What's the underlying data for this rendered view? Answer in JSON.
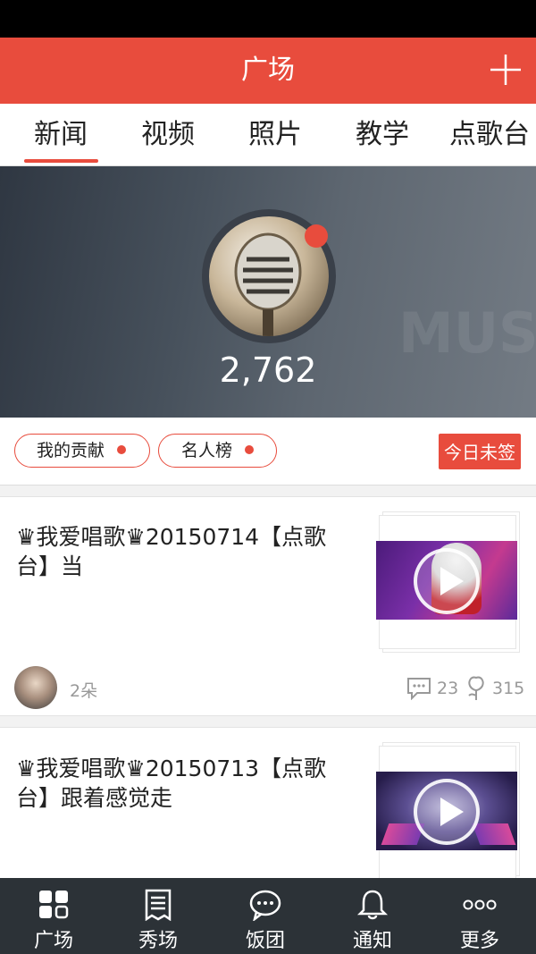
{
  "header": {
    "title": "广场",
    "add_icon": "plus-icon"
  },
  "tabs": [
    {
      "label": "新闻",
      "active": true
    },
    {
      "label": "视频",
      "active": false
    },
    {
      "label": "照片",
      "active": false
    },
    {
      "label": "教学",
      "active": false
    },
    {
      "label": "点歌台",
      "active": false
    }
  ],
  "hero": {
    "count": "2,762",
    "bg_text": "MUSI",
    "avatar_icon": "microphone-icon"
  },
  "pills": {
    "contribution": "我的贡献",
    "celebrity": "名人榜",
    "signin": "今日未签"
  },
  "posts": [
    {
      "title": "♛我爱唱歌♛20150714【点歌台】当",
      "flowers": "2朵",
      "comments": "23",
      "likes": "315"
    },
    {
      "title": "♛我爱唱歌♛20150713【点歌台】跟着感觉走"
    }
  ],
  "bottom_nav": [
    {
      "label": "广场",
      "icon": "grid-icon"
    },
    {
      "label": "秀场",
      "icon": "document-icon"
    },
    {
      "label": "饭团",
      "icon": "chat-bubble-icon"
    },
    {
      "label": "通知",
      "icon": "bell-icon"
    },
    {
      "label": "更多",
      "icon": "more-dots-icon"
    }
  ],
  "colors": {
    "accent": "#e84c3d",
    "nav_bg": "#2c3237"
  }
}
